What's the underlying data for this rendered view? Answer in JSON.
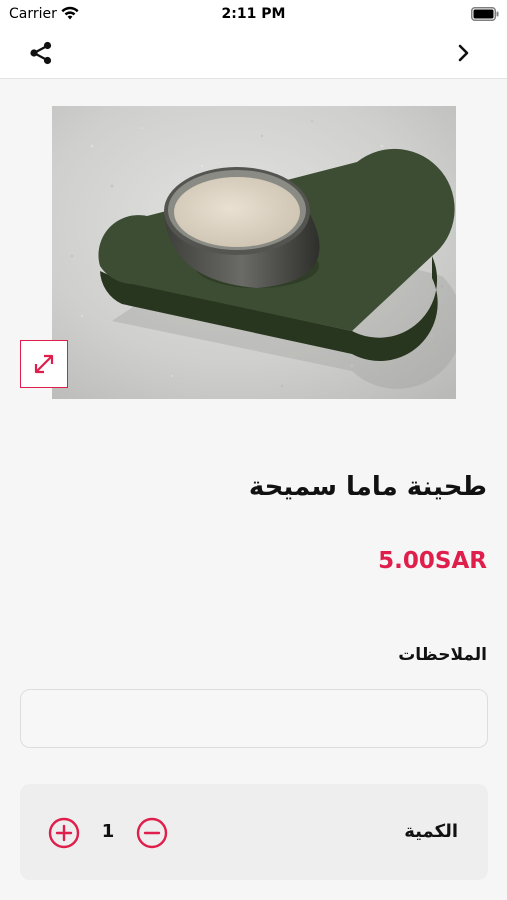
{
  "status_bar": {
    "carrier": "Carrier",
    "time": "2:11 PM"
  },
  "nav": {
    "share_icon": "share-icon",
    "back_icon": "chevron-right-icon"
  },
  "product": {
    "name": "طحينة ماما سميحة",
    "price": "5.00SAR",
    "image_alt": "طحينة ماما سميحة"
  },
  "notes": {
    "label": "الملاحظات",
    "value": "",
    "placeholder": ""
  },
  "quantity": {
    "label": "الكمية",
    "value": "1"
  },
  "colors": {
    "accent": "#e01e4c",
    "background": "#f6f6f6",
    "panel": "#eeeeee"
  }
}
